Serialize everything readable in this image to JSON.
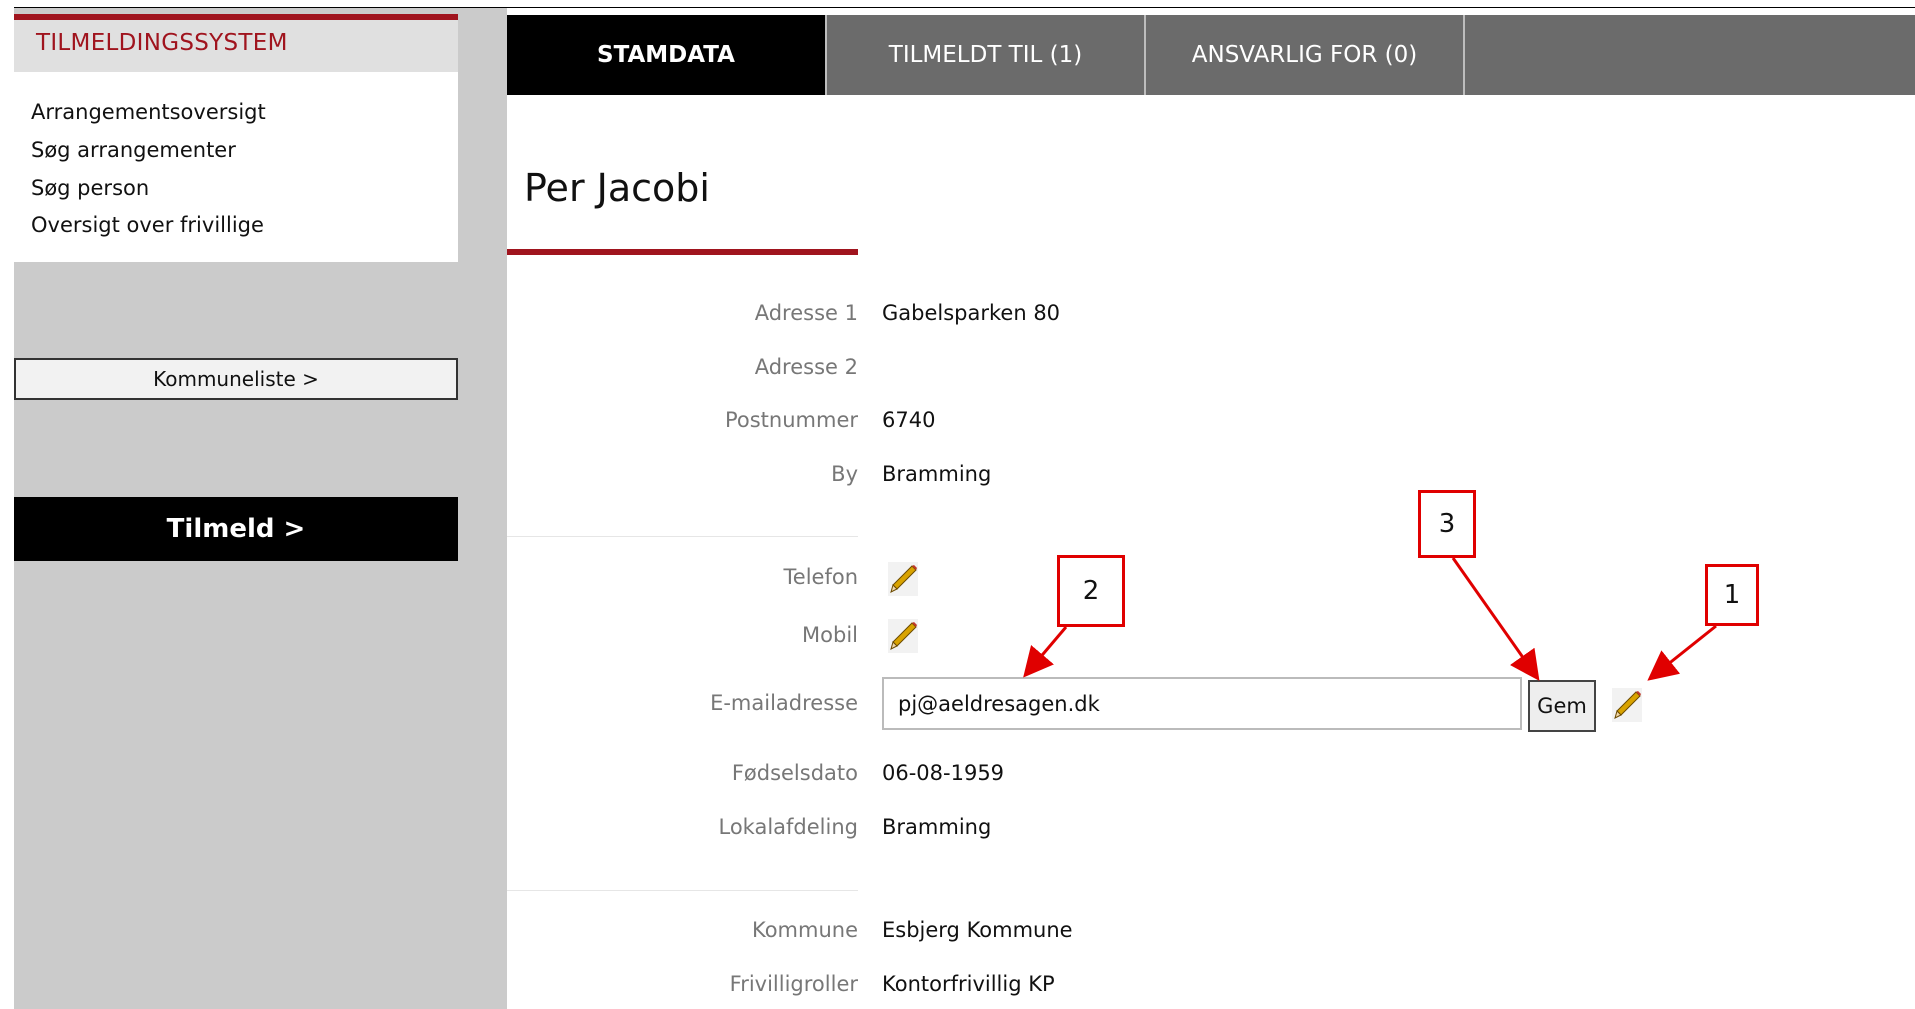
{
  "sidebar": {
    "brand": "TILMELDINGSSYSTEM",
    "menu": [
      "Arrangementsoversigt",
      "Søg arrangementer",
      "Søg person",
      "Oversigt over frivillige"
    ],
    "kommune_button": "Kommuneliste >",
    "tilmeld_button": "Tilmeld >"
  },
  "tabs": [
    {
      "label": "STAMDATA",
      "active": true
    },
    {
      "label": "TILMELDT TIL (1)",
      "active": false
    },
    {
      "label": "ANSVARLIG FOR (0)",
      "active": false
    }
  ],
  "person": {
    "name": "Per Jacobi",
    "fields": {
      "adresse1": {
        "label": "Adresse 1",
        "value": "Gabelsparken 80"
      },
      "adresse2": {
        "label": "Adresse 2",
        "value": ""
      },
      "postnummer": {
        "label": "Postnummer",
        "value": "6740"
      },
      "by": {
        "label": "By",
        "value": "Bramming"
      },
      "telefon": {
        "label": "Telefon",
        "icon": "pencil-icon"
      },
      "mobil": {
        "label": "Mobil",
        "icon": "pencil-icon"
      },
      "email": {
        "label": "E-mailadresse",
        "value": "pj@aeldresagen.dk"
      },
      "fodselsdato": {
        "label": "Fødselsdato",
        "value": "06-08-1959"
      },
      "lokalafdeling": {
        "label": "Lokalafdeling",
        "value": "Bramming"
      },
      "kommune": {
        "label": "Kommune",
        "value": "Esbjerg Kommune"
      },
      "frivilligroller": {
        "label": "Frivilligroller",
        "value": "Kontorfrivillig KP"
      }
    },
    "save_button": "Gem"
  },
  "annotations": [
    "1",
    "2",
    "3"
  ],
  "colors": {
    "brand_red": "#a0141e",
    "callout_red": "#e00000",
    "sidebar_gray": "#cbcbcb",
    "tab_gray": "#6b6b6b"
  }
}
